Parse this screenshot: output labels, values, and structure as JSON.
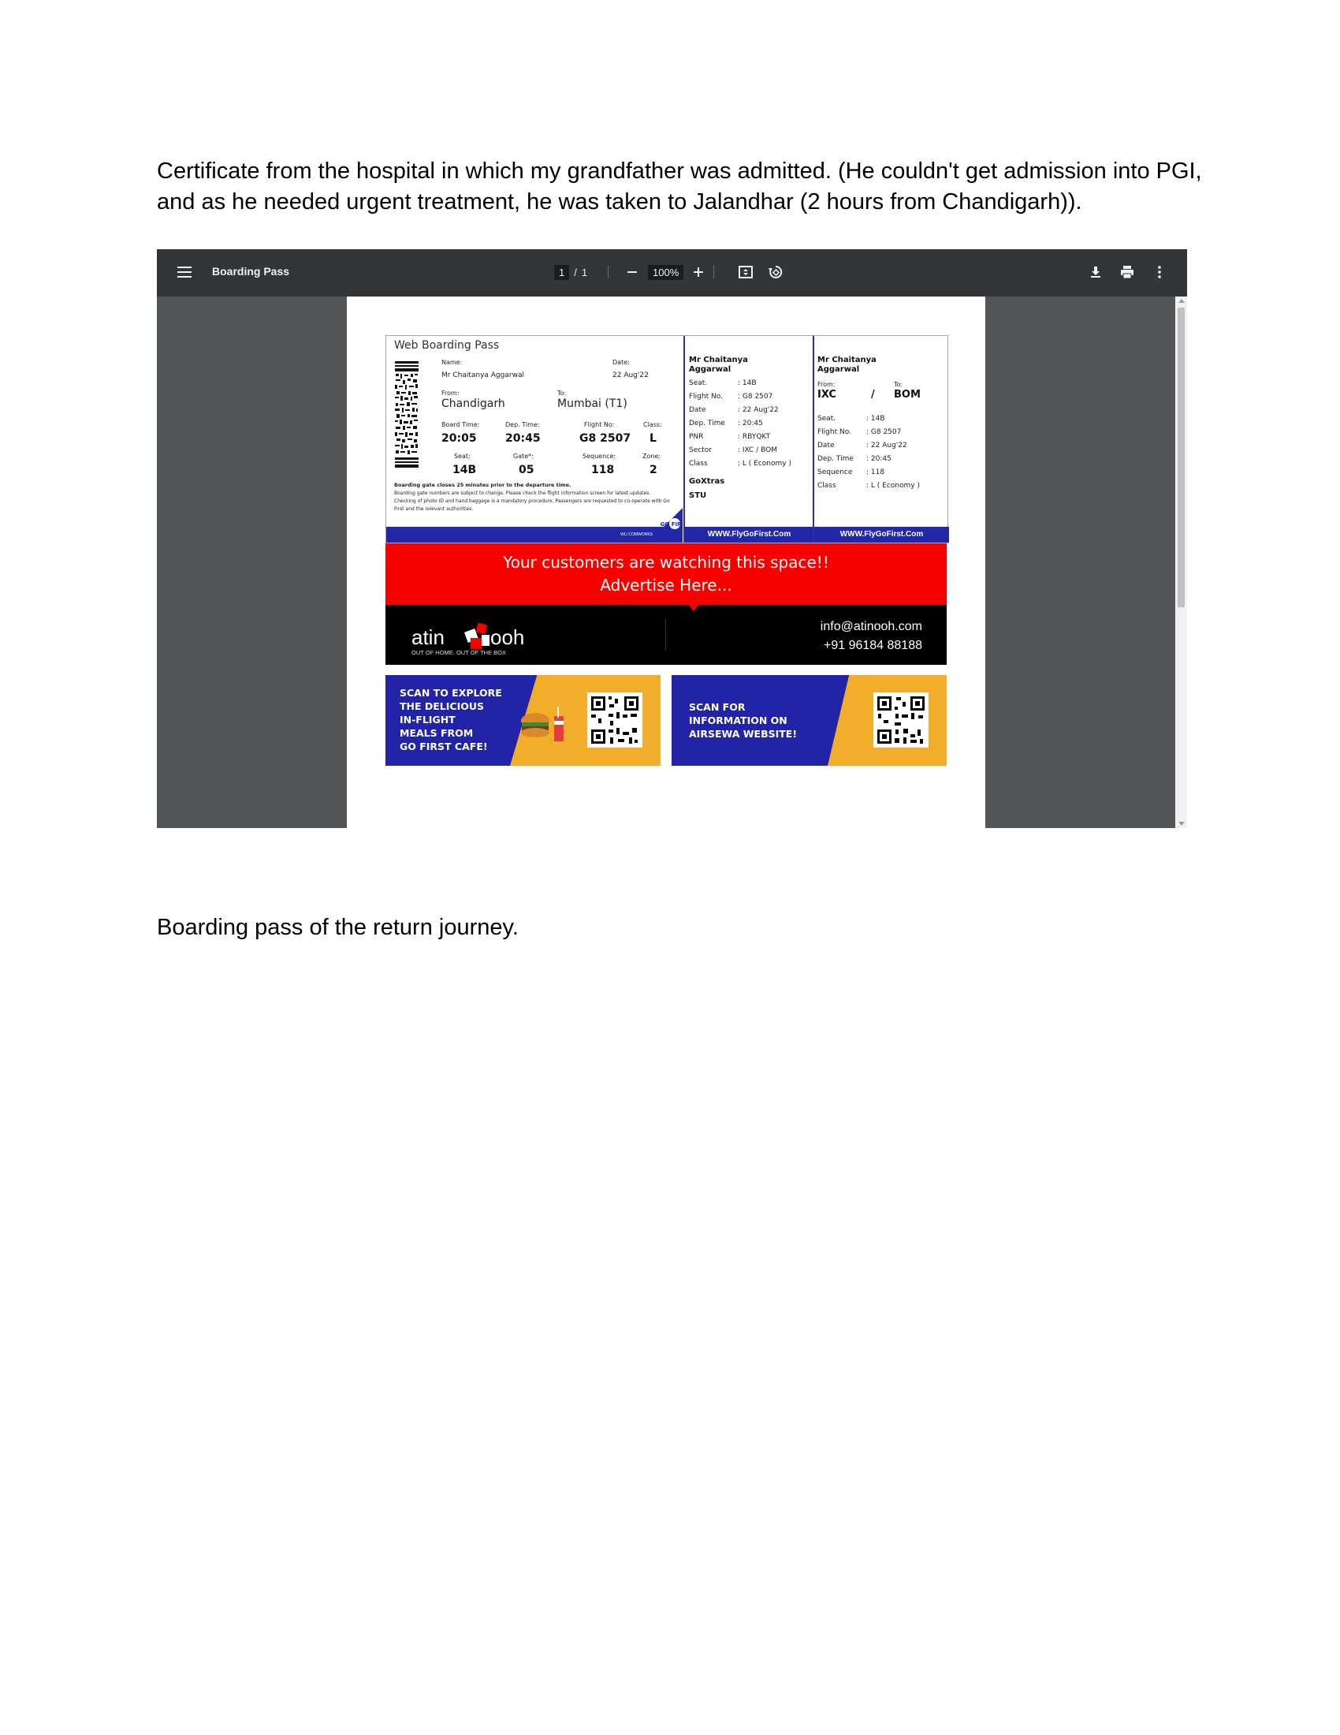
{
  "captions": {
    "first": "Certificate from the hospital in which my grandfather was admitted. (He couldn't get admission into PGI, and as he needed urgent treatment, he was taken to Jalandhar (2 hours from Chandigarh)).",
    "second": "Boarding pass of the return journey."
  },
  "viewer": {
    "title": "Boarding Pass",
    "page_current": "1",
    "page_separator": "/",
    "page_total": "1",
    "zoom": "100%",
    "icons": [
      "menu-icon",
      "zoom-out-icon",
      "zoom-in-icon",
      "fit-page-icon",
      "rotate-icon",
      "download-icon",
      "print-icon",
      "more-options-icon"
    ]
  },
  "boarding_pass": {
    "title": "Web Boarding Pass",
    "name_label": "Name:",
    "name_value": "Mr Chaitanya Aggarwal",
    "date_label": "Date:",
    "date_value": "22 Aug'22",
    "from_label": "From:",
    "from_value": "Chandigarh",
    "to_label": "To:",
    "to_value": "Mumbai (T1)",
    "board_time_label": "Board Time:",
    "board_time_value": "20:05",
    "dep_time_label": "Dep. Time:",
    "dep_time_value": "20:45",
    "flight_no_label": "Flight No:",
    "flight_no_value": "G8 2507",
    "class_label": "Class:",
    "class_value": "L",
    "seat_label": "Seat:",
    "seat_value": "14B",
    "gate_label": "Gate*:",
    "gate_value": "05",
    "sequence_label": "Sequence:",
    "sequence_value": "118",
    "zone_label": "Zone:",
    "zone_value": "2",
    "note_bold": "Boarding gate closes 25 minutes prior to the departure time.",
    "note_text": "Boarding gate numbers are subject to change. Please check the flight information screen for latest updates. Checking of photo ID and hand baggage is a mandatory procedure. Passengers are requested to co-operate with Go First and the relevant authorities.",
    "footer_small": "WLI COMWORKS",
    "logo_text": "GO FIRST",
    "stub1": {
      "name_line1": "Mr Chaitanya",
      "name_line2": "Aggarwal",
      "rows": [
        {
          "k": "Seat.",
          "v": ": 14B"
        },
        {
          "k": "Flight No.",
          "v": ": G8 2507"
        },
        {
          "k": "Date",
          "v": ": 22 Aug'22"
        },
        {
          "k": "Dep. Time",
          "v": ": 20:45"
        },
        {
          "k": "PNR",
          "v": ": RBYQKT"
        },
        {
          "k": "Sector",
          "v": ": IXC / BOM"
        },
        {
          "k": "Class",
          "v": ": L ( Economy )"
        }
      ],
      "extra1": "GoXtras",
      "extra2": "STU",
      "footer": "WWW.FlyGoFirst.Com"
    },
    "stub2": {
      "name_line1": "Mr Chaitanya",
      "name_line2": "Aggarwal",
      "from_label": "From:",
      "to_label": "To:",
      "from_value": "IXC",
      "slash": "/",
      "to_value": "BOM",
      "rows": [
        {
          "k": "Seat.",
          "v": ": 14B"
        },
        {
          "k": "Flight No.",
          "v": ": G8 2507"
        },
        {
          "k": "Date",
          "v": ": 22 Aug'22"
        },
        {
          "k": "Dep. Time",
          "v": ": 20:45"
        },
        {
          "k": "Sequence",
          "v": ": 118"
        },
        {
          "k": "Class",
          "v": ": L ( Economy )"
        }
      ],
      "footer": "WWW.FlyGoFirst.Com"
    }
  },
  "ad": {
    "line1": "Your customers are watching this space!!",
    "line2": "Advertise Here...",
    "logo_word_left": "atin",
    "logo_word_right": "ooh",
    "tagline": "OUT OF HOME. OUT OF THE BOX",
    "email": "info@atinooh.com",
    "phone": "+91 96184 88188"
  },
  "promos": [
    {
      "lines": [
        "SCAN TO EXPLORE",
        "THE DELICIOUS",
        "IN-FLIGHT",
        "MEALS FROM",
        "GO FIRST CAFE!"
      ]
    },
    {
      "lines": [
        "SCAN FOR",
        "INFORMATION ON",
        "AIRSEWA WEBSITE!"
      ]
    }
  ],
  "colors": {
    "viewer_bg": "#525659",
    "toolbar_bg": "#323639",
    "brand_blue": "#2226a8",
    "ad_red": "#f80000",
    "promo_orange": "#f2ad2b"
  }
}
